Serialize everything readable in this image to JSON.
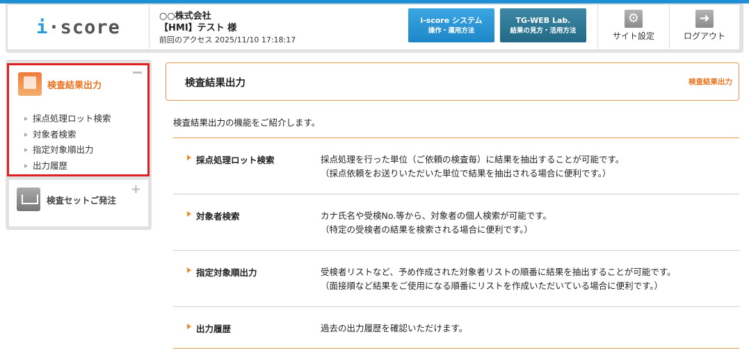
{
  "header": {
    "logo_text_i": "i",
    "logo_text_rest": "·score",
    "company_name": "○○株式会社",
    "user_name": "【HMI】テスト 様",
    "last_access": "前回のアクセス 2025/11/10 17:18:17",
    "btn_iscore_title": "i-score システム",
    "btn_iscore_sub": "操作・運用方法",
    "btn_tgweb_title": "TG-WEB Lab.",
    "btn_tgweb_sub": "結果の見方・活用方法",
    "site_settings_label": "サイト設定",
    "logout_label": "ログアウト"
  },
  "sidebar": {
    "active_panel_title": "検査結果出力",
    "menu": [
      {
        "label": "採点処理ロット検索"
      },
      {
        "label": "対象者検索"
      },
      {
        "label": "指定対象順出力"
      },
      {
        "label": "出力履歴"
      }
    ],
    "order_panel_title": "検査セットご発注"
  },
  "main": {
    "title": "検査結果出力",
    "breadcrumb": "検査結果出力",
    "intro": "検査結果出力の機能をご紹介します。",
    "features": [
      {
        "name": "採点処理ロット検索",
        "desc": "採点処理を行った単位（ご依頼の検査毎）に結果を抽出することが可能です。",
        "note": "（採点依頼をお送りいただいた単位で結果を抽出される場合に便利です。）"
      },
      {
        "name": "対象者検索",
        "desc": "カナ氏名や受検No.等から、対象者の個人検索が可能です。",
        "note": "（特定の受検者の結果を検索される場合に便利です。）"
      },
      {
        "name": "指定対象順出力",
        "desc": "受検者リストなど、予め作成された対象者リストの順番に結果を抽出することが可能です。",
        "note": "（面接順など結果をご使用になる順番にリストを作成いただいている場合に便利です。）"
      },
      {
        "name": "出力履歴",
        "desc": "過去の出力履歴を確認いただけます。",
        "note": ""
      }
    ]
  },
  "colors": {
    "accent_orange": "#e8731f",
    "header_blue": "#1f8fd6",
    "highlight_red": "#e02020"
  }
}
